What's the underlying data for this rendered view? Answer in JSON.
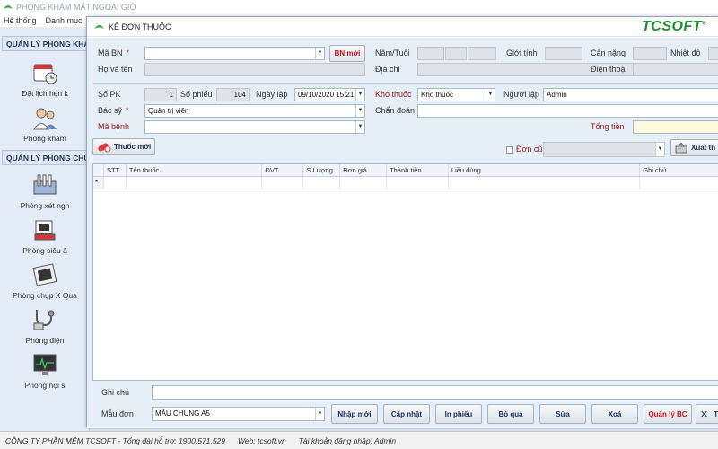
{
  "main_window": {
    "title": "PHÒNG KHÁM MẮT NGOẠI GIỜ",
    "menu": [
      "Hệ thống",
      "Danh mục"
    ],
    "sidebar": {
      "section1": "QUẢN LÝ PHÒNG KHÁM",
      "item_appointment": "Đặt lịch hẹn k",
      "item_clinic": "Phòng khám",
      "section2": "QUẢN LÝ PHÒNG CHỨ",
      "item_lab": "Phòng xét ngh",
      "item_ultrasound": "Phòng siêu â",
      "item_xray": "Phòng chụp X Qua",
      "item_ecg_room": "Phòng điện",
      "item_endoscopy": "Phòng nội s"
    },
    "status_bar": {
      "company": "CÔNG TY PHẦN MỀM TCSOFT - Tổng đài hỗ trợ: 1900.571.529",
      "web": "Web: tcsoft.vn",
      "account": "Tài khoản đăng nhập: Admin"
    }
  },
  "dialog": {
    "title": "KÊ ĐƠN THUỐC",
    "brand": "TCSOFT",
    "brand_mark": "®",
    "patient": {
      "ma_bn_label": "Mã BN",
      "ma_bn_value": "",
      "bn_moi_button": "BN mới",
      "ho_ten_label": "Họ và tên",
      "nam_tuoi_label": "Năm/Tuổi",
      "dia_chi_label": "Địa chỉ",
      "gioi_tinh_label": "Giới tính",
      "can_nang_label": "Cân nặng",
      "nhiet_do_label": "Nhiệt độ",
      "dien_thoai_label": "Điện thoại"
    },
    "prescription": {
      "so_pk_label": "Số PK",
      "so_pk_value": "1",
      "so_phieu_label": "Số phiếu",
      "so_phieu_value": "104",
      "ngay_lap_label": "Ngày lập",
      "ngay_lap_value": "09/10/2020 15:21",
      "kho_thuoc_label": "Kho thuốc",
      "kho_thuoc_value": "Kho thuốc",
      "nguoi_lap_label": "Người lập",
      "nguoi_lap_value": "Admin",
      "bac_sy_label": "Bác sỹ",
      "bac_sy_value": "Quản trị viên",
      "chan_doan_label": "Chẩn đoán",
      "ma_benh_label": "Mã bệnh",
      "tong_tien_label": "Tổng tiền"
    },
    "toolbar": {
      "thuoc_moi_button": "Thuốc mới",
      "don_cu_label": "Đơn cũ",
      "xuat_button": "Xuất th"
    },
    "grid": {
      "columns": [
        "STT",
        "Tên thuốc",
        "ĐVT",
        "S.Lượng",
        "Đơn giá",
        "Thành tiền",
        "Liều dùng",
        "Ghi chú"
      ],
      "new_row_marker": "*"
    },
    "footer": {
      "ghi_chu_label": "Ghi chú",
      "mau_don_label": "Mẫu đơn",
      "mau_don_value": "MẪU CHUNG A5",
      "buttons": {
        "nhap_moi": "Nhập mới",
        "cap_nhat": "Cập nhật",
        "in_phieu": "In phiếu",
        "bo_qua": "Bỏ qua",
        "sua": "Sửa",
        "xoa": "Xoá",
        "quan_ly_bc": "Quản lý BC",
        "close": "T"
      }
    },
    "colors": {
      "brand_green": "#1d8f2c",
      "required_red": "#a01818",
      "panel_blue": "#e6eef8"
    }
  }
}
